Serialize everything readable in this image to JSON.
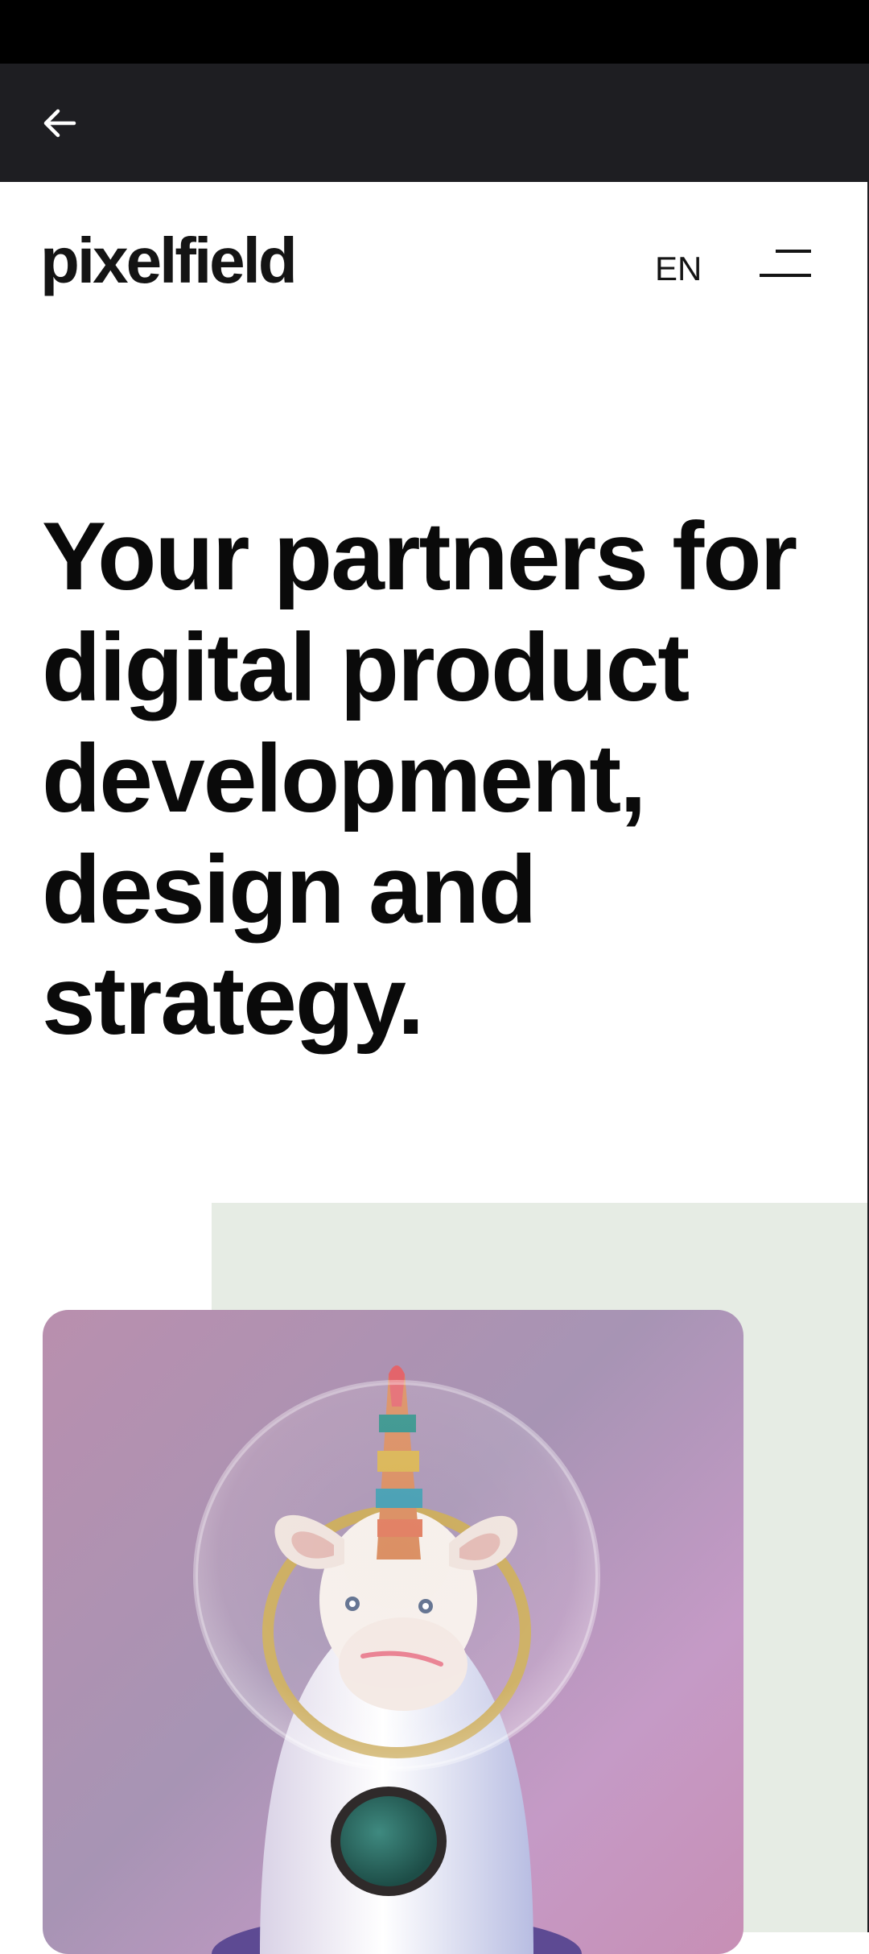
{
  "browser": {
    "back_icon": "arrow-left-icon"
  },
  "header": {
    "logo": "pixelfield",
    "language": "EN",
    "menu_icon": "hamburger-menu-icon"
  },
  "hero": {
    "title": "Your partners for digital product development, design and strategy.",
    "illustration": "unicorn-rocket-illustration"
  },
  "colors": {
    "toolbar": "#1e1e22",
    "text": "#0a0a0a",
    "panel": "#e6ece4"
  }
}
